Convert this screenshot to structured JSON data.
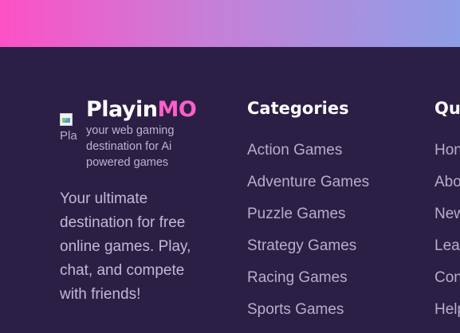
{
  "brand": {
    "name_main": "Playin",
    "name_accent": "MO",
    "logo_alt": "Pla",
    "tagline": "your web gaming destination for Ai powered games"
  },
  "description": "Your ultimate destination for free online games. Play, chat, and compete with friends!",
  "categories": {
    "title": "Categories",
    "links": [
      "Action Games",
      "Adventure Games",
      "Puzzle Games",
      "Strategy Games",
      "Racing Games",
      "Sports Games"
    ]
  },
  "quick_links": {
    "title": "Qu",
    "links": [
      "Hon",
      "Abo",
      "New",
      "Lea",
      "Con",
      "Help"
    ]
  },
  "colors": {
    "background": "#2b1f45",
    "accent": "#ff5fc6",
    "banner_start": "#fd51c6",
    "banner_end": "#8e9ee6"
  }
}
